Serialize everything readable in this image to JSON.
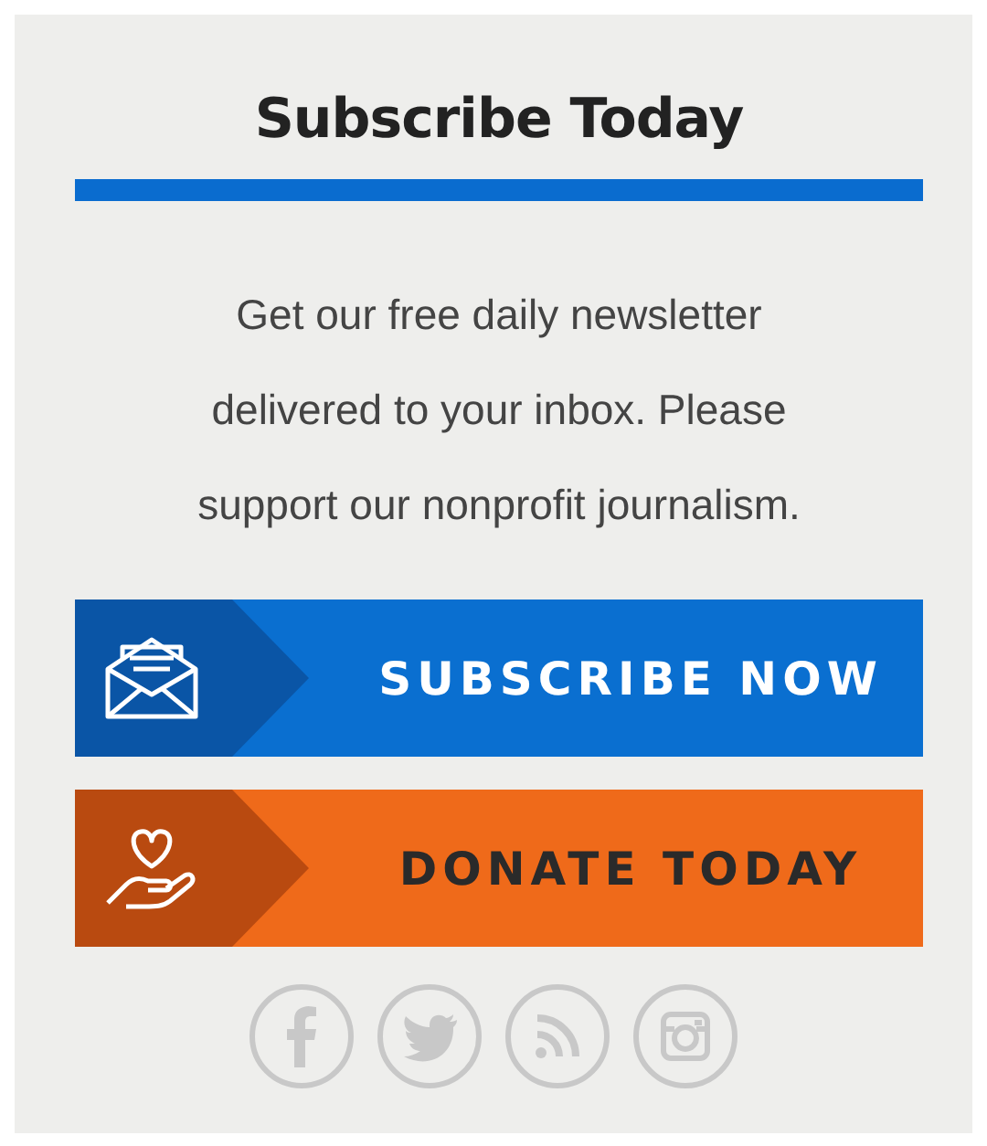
{
  "title": "Subscribe Today",
  "description_lines": [
    "Get our free daily newsletter",
    "delivered to your inbox. Please",
    "support our nonprofit journalism."
  ],
  "buttons": [
    {
      "kind": "subscribe",
      "label": "SUBSCRIBE NOW"
    },
    {
      "kind": "donate",
      "label": "DONATE TODAY"
    }
  ]
}
